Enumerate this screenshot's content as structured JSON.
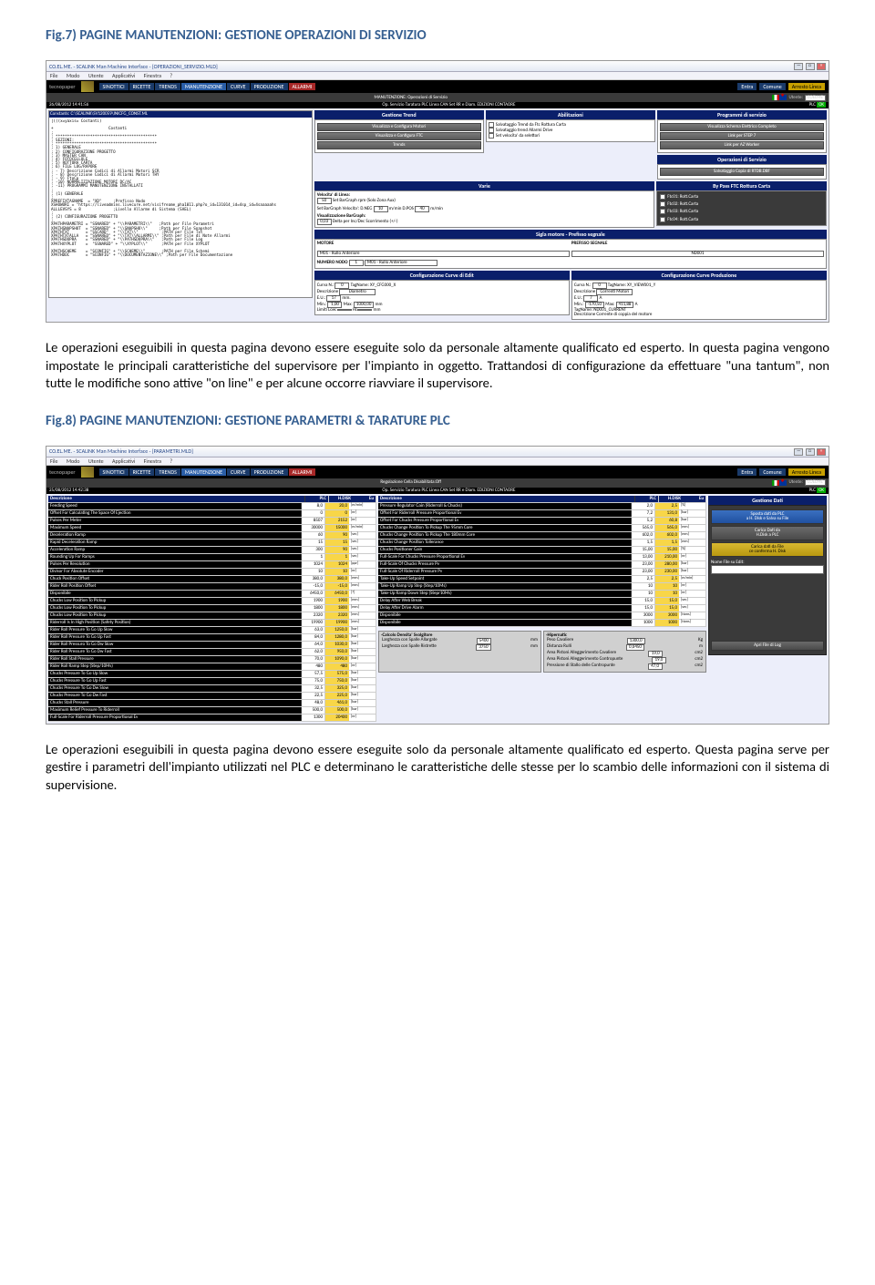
{
  "fig7": {
    "title": "Fig.7)  PAGINE MANUTENZIONI: GESTIONE OPERAZIONI DI SERVIZIO",
    "para": "Le operazioni eseguibili in questa pagina devono essere eseguite solo da personale altamente qualificato ed esperto. In questa pagina vengono impostate le principali caratteristiche del supervisore per l'impianto in oggetto. Trattandosi di configurazione da effettuare \"una tantum\", non tutte le modifiche sono attive \"on line\" e per alcune occorre riavviare il supervisore."
  },
  "fig8": {
    "title": "Fig.8)  PAGINE MANUTENZIONI: GESTIONE PARAMETRI & TARATURE PLC",
    "para": "Le operazioni eseguibili in questa pagina devono essere eseguite solo da personale altamente qualificato ed esperto. Questa pagina serve per gestire i parametri dell'impianto utilizzati nel PLC e determinano le caratteristiche delle stesse per lo scambio delle informazioni con il sistema di supervisione."
  },
  "app": {
    "title1": "CO.EL.ME. - SCALINK Man Machine Interface - [OPERAZIONI_SERVIZIO.MLD]",
    "title2": "CO.EL.ME. - SCALINK Man Machine Interface - [PARAMETRI.MLD]",
    "menu": [
      "File",
      "Modo",
      "Utente",
      "Applicativi",
      "Finestra",
      "?"
    ],
    "brand": "tecnopaper",
    "tabs": [
      "SINOTTICI",
      "RICETTE",
      "TRENDS",
      "MANUTENZIONE",
      "CURVE",
      "PRODUZIONE",
      "ALLARMI"
    ],
    "rtabs": {
      "entra": "Entra",
      "comune": "Comune",
      "arresto": "Arresto Linea"
    },
    "utente_lbl": "Utente:",
    "utente_val": "COELME",
    "sub1_title": "MANUTENZIONE: Operazioni di Servizio",
    "sub1_items": [
      "Op. Servizio",
      "Taratura PLC",
      "Linea CAN",
      "Set RR e Diam.",
      "EDIZIONI",
      "CONTAORE"
    ],
    "sub2_title": "Regolazione Cella Disabilitata:Off",
    "date1": "26/08/2012  14:41:56",
    "date2": "25/08/2012  14:42:38",
    "plc": "PLC",
    "plc_sts": "OK",
    "eu": "Eu"
  },
  "s1": {
    "constHdr": "Constants: C:\\SCALINK\\SV120059\\INICFG_CONST.ML",
    "constBody": "|(((x=yaxis= Costanti)\n\n+ \t\t\t Costanti\n;\n; ********************************************\n; SEZIONI:\n; ********************************************\n; 1) GENERALE\n; 2) CONFIGURAZIONE PROGETTO\n; 3) MASTER CAN\n; 4) FOTOCELLULE\n; 5) ROTTURA CARTA\n; 6) FILE LOG/RAPORE\n; - 7) Descrizione Codici di Allarmi Motori SCR\n; - 8) Descrizione Codici di Allarmi Motori THY\n; - 9) FtoCp\n; -10) NORMALIZZAZIONE MOTORI DC/AC\n; -11) PROGRAMMI MANUTENZIONE INSTALLATI\n;\n; (1) GENERALE\n;\nXPREFIXTAGNAME  = \"XD\"     ;Prefisso Nodo\nXSHOWURI = \"https://liveadmins.livecure.net/visifreame_pha1011.php?o_id=131014_id=4sp_id=4saaaaahs\nALLLEVSYS = 8              ;Livello Allarme di Sistema (SAEL)\n;\n; (2) CONFIGURAZIONE PROGETTO\n;\nXPATHPARAMETRI = \"SSNARED\" + \"\\\\PARAMETRI\\\\\"   ;Path per File Parametri\nXPATHSNAPSHOT  = \"SSNARED\" + \"\\\\SNAPSHO\\\\\"     ;Path per File Snapshot\nXPATHTXT       = \"SSCARD\"  + \"\\\\TXT\\\\\"          ;PATH per File Txt\nXPATHTXTALLA   = \"SSNARED\" + \"\\\\TXT\\\\ALLARMI\\\\\" ;Path per File di Note Allarmi\nXPATHSDOPRA    = \"SSNARED\" + \"\\\\PATHSDOPRA\\\\\"   ;Path per File Log\nXPATHXYPLOT    =  \"SSNARED\" + \"\\\\XYPLOT\\\\\"      ;PATH per File XYPLOT\n\nXPATHSCHEME    = \"SCONFIG\" + \"\\\\SCHEME\\\\\"       ;PATH per File Schemi\nXPATHDOC       = \"SCONFIG\" + \"\\\\DOCUMENTAZIONE\\\\\" ;Path per File Documentazione",
    "panels": {
      "gtrend": "Gestione Trend",
      "gtrend_btns": [
        "Visualizza e Configura Motori",
        "Visualizza e Configura FTC",
        "Trends"
      ],
      "abil": "Abilitazioni",
      "abil_items": [
        "Salvataggio Trend da Ftc Rottura Carta",
        "Salvataggio trend Allarmi Drive",
        "Set velocita' da selettori"
      ],
      "prog": "Programmi di servizio",
      "prog_items": [
        "Visualizza Schema Elettrico Completo",
        "Link per STEP 7",
        "Link per AZ Worker"
      ],
      "opserv": "Operazioni di Servizio",
      "opserv_btn": "Salvataggio Copia di RTDB.DBF",
      "bypass": "By Pass FTC Rottura Carta",
      "bypass_items": [
        "Ftc01: Rott.Carta",
        "Ftc02: Rott.Carta",
        "Ftc03: Rott.Carta",
        "Ftc04: Rott.Carta"
      ],
      "varie": "Varie",
      "vel_lbl": "Velocita' di Linea:",
      "vel_val": "50",
      "vel_unit": "Set BarGraph rpm (Solo Zona Aux)",
      "sbg_lbl": "Set BarGraph Velocita':",
      "sbg_dneg": "D.NEG",
      "sbg_dneg_v": "10",
      "sbg_mm": "m/min",
      "sbg_dpos": "D.POS",
      "sbg_dpos_v": "40",
      "sbg_mm2": "m/min",
      "vbar_lbl": "Visualizzazione BarGraph:",
      "vbar_val": "0,03",
      "vbar_sfx": "Delta per Inc/Dec Scorrimento (+/-)",
      "sigla": "Sigla motore - Prefisso segnale",
      "mot_lbl": "MOTORE",
      "mot_val": "M01 - Rullo Anteriore",
      "pref_lbl": "PREFISSO SEGNALE",
      "pref_val": "ND001",
      "nn_lbl": "NUMERO NODO",
      "nn_val": "1",
      "nn_desc": "M01 - Rullo Anteriore",
      "cce": "Configurazione Curve di Edit",
      "ccp": "Configurazione Curve Produzione",
      "curva_lbl": "Curva N.:",
      "curva_v": "0",
      "tag_lbl": "TagName:",
      "tag_v1": "XY_CFG000_X",
      "tag_v2": "XY_VIEW001_Y",
      "desc_lbl": "Descrizione",
      "desc_v1": "Diametro",
      "desc_v2": "Correnti Motori",
      "eu_lbl": "E.U.:",
      "eu_v1": "17",
      "eu_u1": "mm.",
      "eu_v2": "7",
      "eu_u2": "A",
      "min_lbl": "Min.:",
      "min_v": "1,00",
      "max_lbl": "Max:",
      "max_v": "1000,00",
      "un_mm": "mm",
      "minp": "-170,50",
      "maxp": "411,88",
      "unp": "A",
      "lim_lbl": "Limiti",
      "low_lbl": "Low:",
      "hi_lbl": "Hi:",
      "low_v": "",
      "hi_v": "",
      "lim_u": "mm",
      "ptag": "TagName:",
      "ptag_v": "ND001_CURRENT",
      "pdesc": "Descrizione",
      "pdesc_v": "Corrente di coppia del motore"
    }
  },
  "s2": {
    "hdr": {
      "descr": "Descrizione",
      "plc": "PLC",
      "hdisk": "H.DISK",
      "eu": "Eu",
      "gdati": "Gestione Dati"
    },
    "left": [
      [
        "Feeding Speed",
        "8,0",
        "20,0",
        "[m/min]"
      ],
      [
        "Offset For Calculating The Space Of Ejection",
        "0",
        "0",
        "[nr]"
      ],
      [
        "Pulses Per Meter",
        "8507",
        "2152",
        "[nr]"
      ],
      [
        "Maximum Speed",
        "30000",
        "15000",
        "[m/min]"
      ],
      [
        "Deceleration Ramp",
        "60",
        "90",
        "[sec]"
      ],
      [
        "Rapid Deceleration Ramp",
        "15",
        "15",
        "[sec]"
      ],
      [
        "Acceleration Ramp",
        "300",
        "90",
        "[sec]"
      ],
      [
        "Rounding Up For Ramps",
        "1",
        "1",
        "[sec]"
      ],
      [
        "Pulses Per Revolution",
        "1024",
        "1024",
        "[ppr]"
      ],
      [
        "Divisor For Absolute Encoder",
        "10",
        "10",
        "[nr]"
      ],
      [
        "Chuck Position Offset",
        "380,0",
        "380,0",
        "[mm]"
      ],
      [
        "Rider Roll Position Offset",
        "-15,0",
        "-15,0",
        "[mm]"
      ],
      [
        "Disponibile",
        "6450,0",
        "6450,0",
        "[?]"
      ],
      [
        "Chucks Low Position To Pickup",
        "1900",
        "1900",
        "[mm]"
      ],
      [
        "Chucks Low Position To Pickup",
        "1800",
        "1800",
        "[mm]"
      ],
      [
        "Chucks Low Position To Pickup",
        "2320",
        "2320",
        "[mm]"
      ],
      [
        "Riderroll Is In High Position (Safety Position)",
        "19900",
        "19900",
        "[mm]"
      ],
      [
        "Rider Roll Pressure To Go Up Slow",
        "63,0",
        "1250,0",
        "[bar]"
      ],
      [
        "Rider Roll Pressure To Go Up Fast",
        "84,0",
        "1280,0",
        "[bar]"
      ],
      [
        "Rider Roll Pressuro To Go Dw Slow",
        "64,0",
        "1030,0",
        "[bar]"
      ],
      [
        "Rider Roll Pressure To Go Dw Fast",
        "62,0",
        "950,0",
        "[bar]"
      ],
      [
        "Rider Roll Stall Pressure",
        "70,0",
        "1090,0",
        "[bar]"
      ],
      [
        "Rider Roll Ramp Step (Step/10Ms)",
        "480",
        "480",
        "[nr]"
      ],
      [
        "Chucks Pressure To Go Up Slow",
        "57,5",
        "575,0",
        "[bar]"
      ],
      [
        "Chucks Pressure To Go Up Fast",
        "75,0",
        "750,0",
        "[bar]"
      ],
      [
        "Chucks Pressure To Go Dw Slow",
        "32,5",
        "325,0",
        "[bar]"
      ],
      [
        "Chucks Pressure To Go Dw Fast",
        "22,5",
        "225,0",
        "[bar]"
      ],
      [
        "Chucks Stall Pressure",
        "48,0",
        "461,0",
        "[bar]"
      ],
      [
        "Maximum Relief Pressure To Riderroll",
        "500,0",
        "500,0",
        "[bar]"
      ],
      [
        "Full-Scale For Riderroll Pressure Proportional Ev",
        "1300",
        "20400",
        "[nr]"
      ]
    ],
    "right": [
      [
        "Pressure Regulator Gain (Riderroll & Chucks)",
        "2,0",
        "2,5",
        "[%]"
      ],
      [
        "Offset For Riderroll Pressure Proportional Ev",
        "7,2",
        "131,0",
        "[bar]"
      ],
      [
        "Offset For Chucks Pressure Proportional Ev",
        "5,2",
        "60,8",
        "[bar]"
      ],
      [
        "Chucks Change Position To Pickup The 95mm Core",
        "565,0",
        "565,0",
        "[mm]"
      ],
      [
        "Chucks Change Position To Pickup The 180mm Core",
        "602,0",
        "602,0",
        "[mm]"
      ],
      [
        "Chucks Change Position Tollerance",
        "1,5",
        "1,5",
        "[mm]"
      ],
      [
        "Chucks Positioner Gain",
        "15,00",
        "15,00",
        "[%]"
      ],
      [
        "Full-Scale For Chucks Pressure Proportional Ev",
        "13,00",
        "210,00",
        "[nr]"
      ],
      [
        "Full-Scale Of Chucks Pressure Pv",
        "23,00",
        "280,00",
        "[bar]"
      ],
      [
        "Full-Scale Of Riderroll Pressure Pv",
        "23,00",
        "230,00",
        "[bar]"
      ],
      [
        "Take-Up Speed Setpoint",
        "2,5",
        "2,5",
        "[m/min]"
      ],
      [
        "Take-Up Ramp Up Step (Step/10Ms)",
        "10",
        "10",
        "[nr]"
      ],
      [
        "Take-Up Ramp Down Step (Stepr10Ms)",
        "10",
        "10",
        "[nr]"
      ],
      [
        "Delay After Web Break",
        "15,0",
        "15,0",
        "[sec]"
      ],
      [
        "Delay After Drive Alarm",
        "15,0",
        "15,0",
        "[sec]"
      ],
      [
        "Disponibile",
        "3000",
        "3000",
        "[Nons]"
      ],
      [
        "Disponibile",
        "1000",
        "1000",
        "[Nons]"
      ]
    ],
    "calc": {
      "title": "-Calcolo Densita' Svolgitore",
      "r1l": "Larghezza con Spalle Allargate",
      "r1v": "5400",
      "r1u": "mm",
      "r2l": "Larghezza con Spalle Ristrette",
      "r2v": "3750",
      "r2u": "mm"
    },
    "hip": {
      "title": "-Hipernatic",
      "rows": [
        [
          "Peso Cavaliere",
          "1300,0",
          "Kg"
        ],
        [
          "Distanza Rulli",
          "0,6450",
          "m"
        ],
        [
          "Area Pistoni Alleggerimento Cavaliere",
          "19,0",
          "cm2"
        ],
        [
          "Area Pistoni Alleggerimento Contropunte",
          "19,0",
          "cm2"
        ],
        [
          "Pressione di Stallo delle Contropunte",
          "47,0",
          "cm2"
        ]
      ]
    },
    "side": {
      "b1": "Sposta dati da PLC\na H. Disk e Salva su File",
      "b2": "Carica Dati da\nH.Disk a PLC",
      "b3": "Carica dati da File\nce conferma H. Disk",
      "flbl": "Nome File su Edit:",
      "logbtn": "Apri File di Log"
    }
  }
}
